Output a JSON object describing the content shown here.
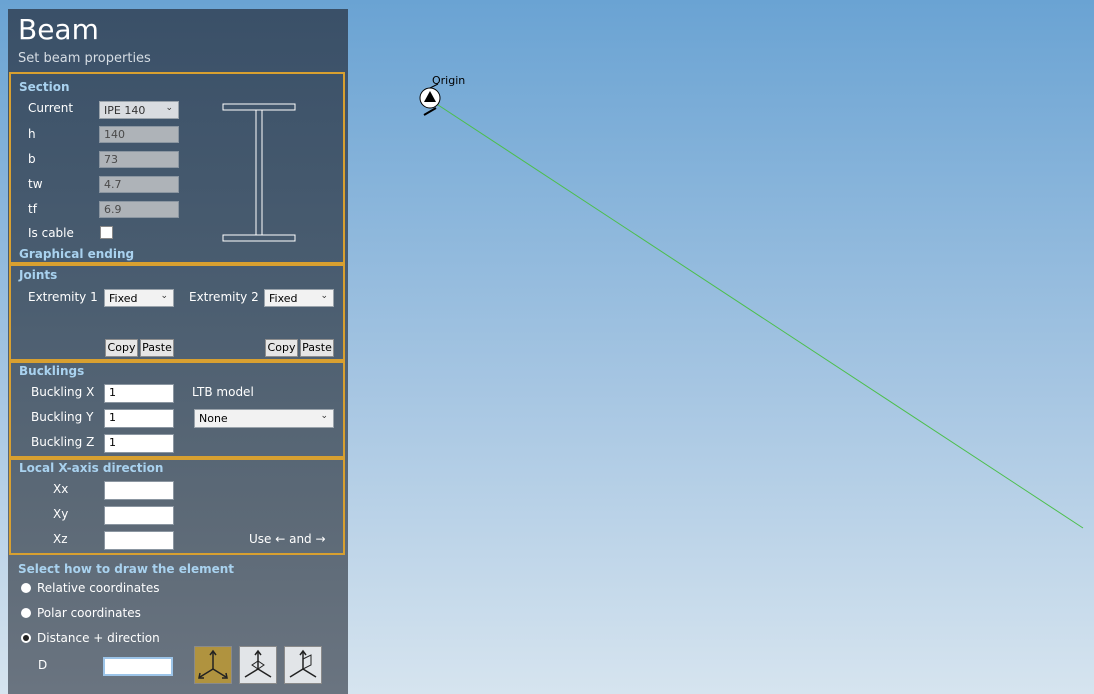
{
  "panel": {
    "title": "Beam",
    "subtitle": "Set beam properties"
  },
  "section": {
    "header": "Section",
    "current_label": "Current",
    "current_value": "IPE 140",
    "h_label": "h",
    "h_value": "140",
    "b_label": "b",
    "b_value": "73",
    "tw_label": "tw",
    "tw_value": "4.7",
    "tf_label": "tf",
    "tf_value": "6.9",
    "is_cable_label": "Is cable",
    "graphical_ending": "Graphical ending"
  },
  "joints": {
    "header": "Joints",
    "ext1_label": "Extremity 1",
    "ext1_value": "Fixed",
    "ext2_label": "Extremity 2",
    "ext2_value": "Fixed",
    "copy": "Copy",
    "paste": "Paste"
  },
  "bucklings": {
    "header": "Bucklings",
    "x_label": "Buckling X",
    "x_value": "1",
    "y_label": "Buckling Y",
    "y_value": "1",
    "z_label": "Buckling Z",
    "z_value": "1",
    "ltb_label": "LTB model",
    "ltb_value": "None"
  },
  "local_axis": {
    "header": "Local X-axis direction",
    "xx_label": "Xx",
    "xy_label": "Xy",
    "xz_label": "Xz",
    "hint": "Use ← and →"
  },
  "draw_mode": {
    "header": "Select how to draw the element",
    "options": [
      "Relative coordinates",
      "Polar coordinates",
      "Distance + direction"
    ],
    "selected": "Distance + direction",
    "d_label": "D"
  },
  "viewport": {
    "origin_label": "Origin",
    "beam_color": "#4cbf4c"
  },
  "colors": {
    "group_border": "#d8a030",
    "header_text": "#a9d2ef",
    "active_axis_button": "#b0933f"
  }
}
